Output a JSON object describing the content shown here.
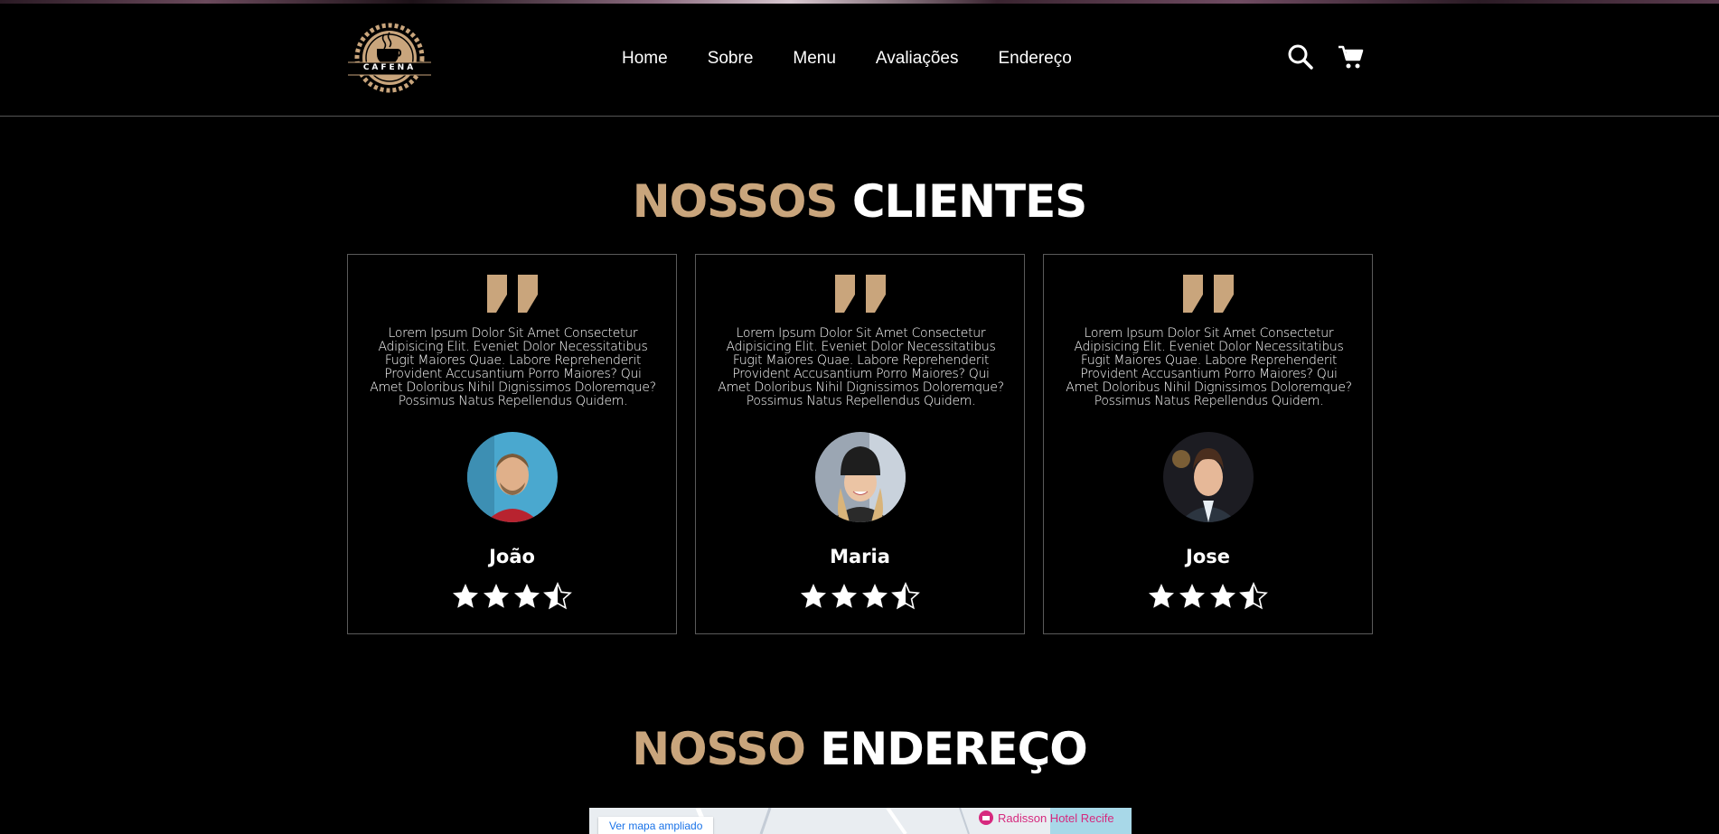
{
  "header": {
    "logo_text": "CAFENA",
    "nav": [
      "Home",
      "Sobre",
      "Menu",
      "Avaliações",
      "Endereço"
    ],
    "icons": [
      "search-icon",
      "cart-icon"
    ]
  },
  "clients_section": {
    "title_accent": "NOSSOS",
    "title_rest": "CLIENTES",
    "accent_color": "#c9a57c",
    "testimonials": [
      {
        "text": "Lorem Ipsum Dolor Sit Amet Consectetur Adipisicing Elit. Eveniet Dolor Necessitatibus Fugit Maiores Quae. Labore Reprehenderit Provident Accusantium Porro Maiores? Qui Amet Doloribus Nihil Dignissimos Doloremque? Possimus Natus Repellendus Quidem.",
        "name": "João",
        "rating": 3.5
      },
      {
        "text": "Lorem Ipsum Dolor Sit Amet Consectetur Adipisicing Elit. Eveniet Dolor Necessitatibus Fugit Maiores Quae. Labore Reprehenderit Provident Accusantium Porro Maiores? Qui Amet Doloribus Nihil Dignissimos Doloremque? Possimus Natus Repellendus Quidem.",
        "name": "Maria",
        "rating": 3.5
      },
      {
        "text": "Lorem Ipsum Dolor Sit Amet Consectetur Adipisicing Elit. Eveniet Dolor Necessitatibus Fugit Maiores Quae. Labore Reprehenderit Provident Accusantium Porro Maiores? Qui Amet Doloribus Nihil Dignissimos Doloremque? Possimus Natus Repellendus Quidem.",
        "name": "Jose",
        "rating": 3.5
      }
    ]
  },
  "address_section": {
    "title_accent": "NOSSO",
    "title_rest": "ENDEREÇO",
    "map_button": "Ver mapa ampliado",
    "map_poi": "Radisson Hotel Recife"
  }
}
